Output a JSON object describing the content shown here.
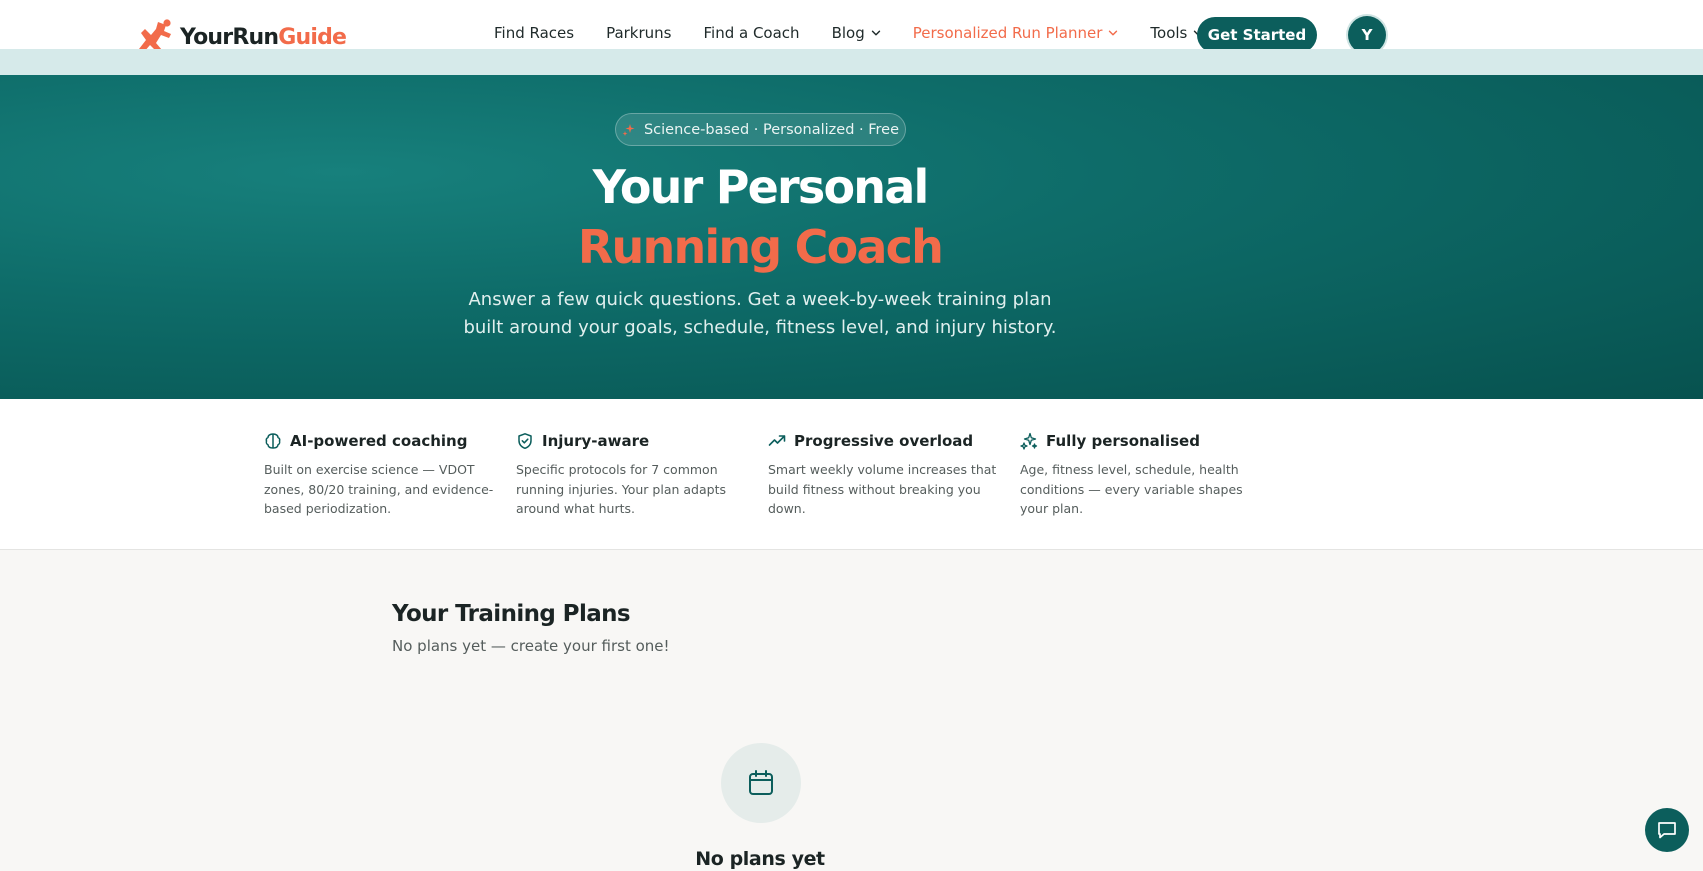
{
  "header": {
    "logo_part1": "YourRun",
    "logo_part2": "Guide",
    "nav": [
      {
        "label": "Find Races"
      },
      {
        "label": "Parkruns"
      },
      {
        "label": "Find a Coach"
      },
      {
        "label": "Blog"
      },
      {
        "label": "Personalized Run Planner"
      },
      {
        "label": "Tools"
      }
    ],
    "cta": "Get Started",
    "avatar_initial": "Y"
  },
  "hero": {
    "badge": "Science-based · Personalized · Free",
    "title_line1": "Your Personal",
    "title_line2": "Running Coach",
    "subtitle": "Answer a few quick questions. Get a week-by-week training plan built around your goals, schedule, fitness level, and injury history."
  },
  "features": [
    {
      "title": "AI-powered coaching",
      "desc": "Built on exercise science — VDOT zones, 80/20 training, and evidence-based periodization.",
      "icon": "brain-icon"
    },
    {
      "title": "Injury-aware",
      "desc": "Specific protocols for 7 common running injuries. Your plan adapts around what hurts.",
      "icon": "shield-check-icon"
    },
    {
      "title": "Progressive overload",
      "desc": "Smart weekly volume increases that build fitness without breaking you down.",
      "icon": "trending-up-icon"
    },
    {
      "title": "Fully personalised",
      "desc": "Age, fitness level, schedule, health conditions — every variable shapes your plan.",
      "icon": "sparkles-icon"
    }
  ],
  "plans": {
    "title": "Your Training Plans",
    "subtitle": "No plans yet — create your first one!",
    "empty_title": "No plans yet"
  },
  "colors": {
    "brand_teal": "#0c5e5c",
    "accent_orange": "#f26b4a"
  }
}
